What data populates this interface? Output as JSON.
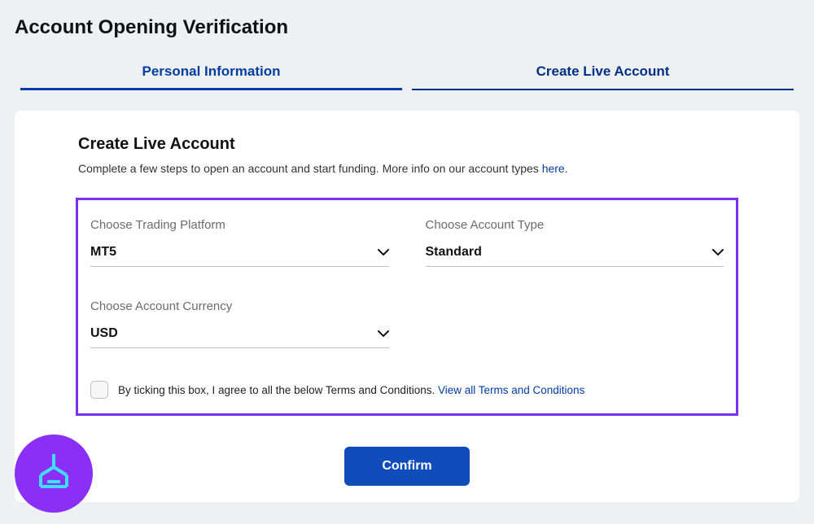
{
  "header": {
    "title": "Account Opening Verification"
  },
  "tabs": [
    {
      "label": "Personal Information",
      "active": true
    },
    {
      "label": "Create Live Account",
      "active": false
    }
  ],
  "section": {
    "title": "Create Live Account",
    "subtitle_text": "Complete a few steps to open an account and start funding. More info on our account types ",
    "subtitle_link": "here",
    "subtitle_suffix": "."
  },
  "form": {
    "platform": {
      "label": "Choose Trading Platform",
      "value": "MT5"
    },
    "account_type": {
      "label": "Choose Account Type",
      "value": "Standard"
    },
    "currency": {
      "label": "Choose Account Currency",
      "value": "USD"
    },
    "terms": {
      "text": "By ticking this box, I agree to all the below Terms and Conditions. ",
      "link": "View all Terms and Conditions"
    }
  },
  "actions": {
    "confirm": "Confirm"
  }
}
